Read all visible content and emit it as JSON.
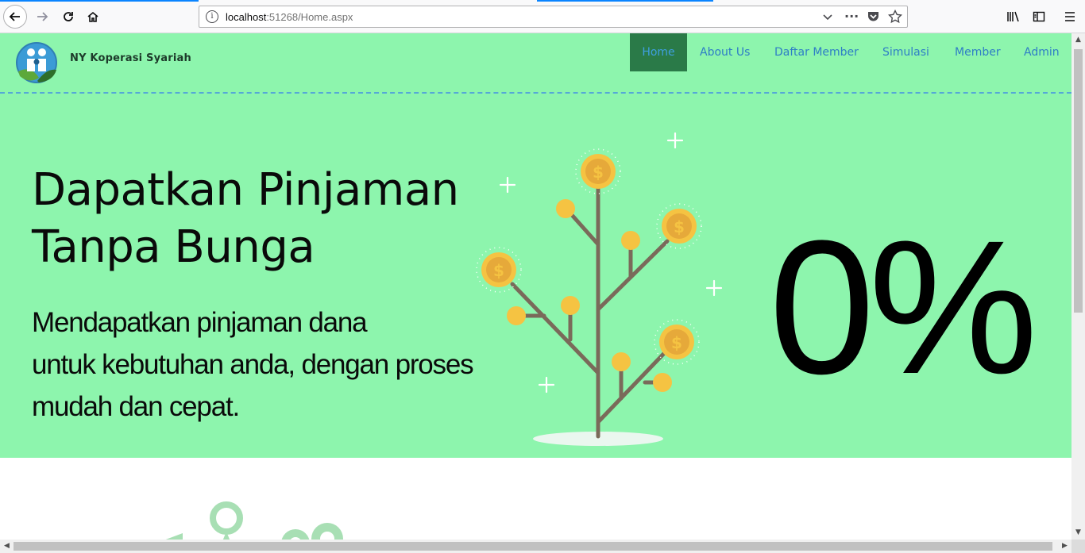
{
  "browser": {
    "url_host": "localhost",
    "url_rest": ":51268/Home.aspx"
  },
  "site": {
    "brand": "NY Koperasi Syariah",
    "nav": [
      {
        "label": "Home",
        "active": true
      },
      {
        "label": "About Us",
        "active": false
      },
      {
        "label": "Daftar Member",
        "active": false
      },
      {
        "label": "Simulasi",
        "active": false
      },
      {
        "label": "Member",
        "active": false
      },
      {
        "label": "Admin",
        "active": false
      }
    ]
  },
  "hero": {
    "headline_1": "Dapatkan Pinjaman",
    "headline_2": "Tanpa Bunga",
    "sub_1": "Mendapatkan pinjaman dana",
    "sub_2": "untuk kebutuhan anda, dengan proses",
    "sub_3": "mudah dan cepat.",
    "big_value": "0%"
  },
  "colors": {
    "hero_bg": "#8df5ad",
    "nav_active_bg": "#2a7a48",
    "nav_link": "#2e7dc6",
    "coin": "#f5c342"
  },
  "icons": [
    "back-icon",
    "forward-icon",
    "reload-icon",
    "home-icon",
    "info-icon",
    "dropdown-icon",
    "more-icon",
    "pocket-icon",
    "bookmark-star-icon",
    "library-icon",
    "sidebar-icon",
    "menu-icon"
  ]
}
